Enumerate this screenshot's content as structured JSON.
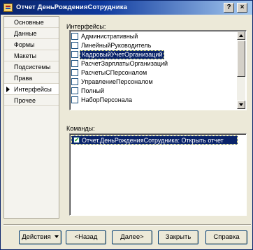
{
  "window": {
    "title": "Отчет ДеньРожденияСотрудника",
    "help_glyph": "?",
    "close_glyph": "×"
  },
  "nav": {
    "items": [
      {
        "label": "Основные",
        "active": false
      },
      {
        "label": "Данные",
        "active": false
      },
      {
        "label": "Формы",
        "active": false
      },
      {
        "label": "Макеты",
        "active": false
      },
      {
        "label": "Подсистемы",
        "active": false
      },
      {
        "label": "Права",
        "active": false
      },
      {
        "label": "Интерфейсы",
        "active": true
      },
      {
        "label": "Прочее",
        "active": false
      }
    ]
  },
  "interfaces": {
    "label": "Интерфейсы:",
    "items": [
      {
        "label": "Административный",
        "checked": false,
        "selected": false
      },
      {
        "label": "ЛинейныйРуководитель",
        "checked": false,
        "selected": false
      },
      {
        "label": "КадровыйУчетОрганизаций",
        "checked": false,
        "selected": true
      },
      {
        "label": "РасчетЗарплатыОрганизаций",
        "checked": false,
        "selected": false
      },
      {
        "label": "РасчетыСПерсоналом",
        "checked": false,
        "selected": false
      },
      {
        "label": "УправлениеПерсоналом",
        "checked": false,
        "selected": false
      },
      {
        "label": "Полный",
        "checked": false,
        "selected": false
      },
      {
        "label": "НаборПерсонала",
        "checked": false,
        "selected": false
      }
    ]
  },
  "commands": {
    "label": "Команды:",
    "items": [
      {
        "label": "Отчет.ДеньРожденияСотрудника: Открыть отчет",
        "checked": true,
        "selected": true
      }
    ]
  },
  "footer": {
    "actions_label": "Действия",
    "back_label": "<Назад",
    "next_label": "Далее>",
    "close_label": "Закрыть",
    "help_label": "Справка"
  },
  "colors": {
    "selection": "#0a246a",
    "title_gradient_start": "#0a246a",
    "title_gradient_end": "#a6caf0",
    "checkmark": "#21a121"
  }
}
